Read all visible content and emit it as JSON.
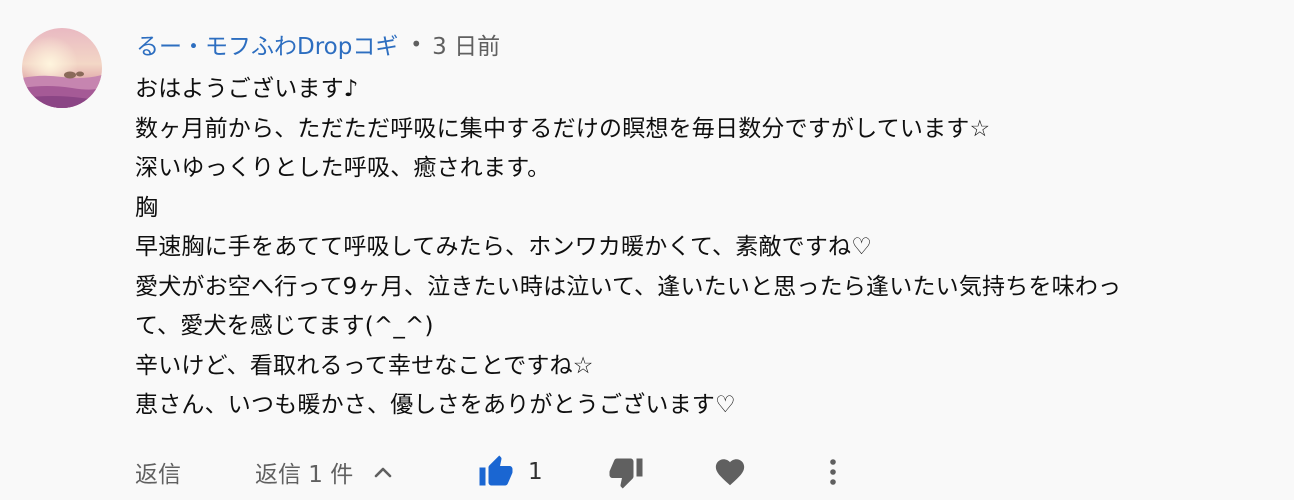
{
  "comment": {
    "author": "るー・モフふわDropコギ",
    "separator": "•",
    "time": "3 日前",
    "lines": [
      "おはようございます♪",
      "数ヶ月前から、ただただ呼吸に集中するだけの瞑想を毎日数分ですがしています☆",
      "深いゆっくりとした呼吸、癒されます。",
      "胸",
      "早速胸に手をあてて呼吸してみたら、ホンワカ暖かくて、素敵ですね♡",
      "愛犬がお空へ行って9ヶ月、泣きたい時は泣いて、逢いたいと思ったら逢いたい気持ちを味わっ",
      "て、愛犬を感じてます(^_^)",
      "辛いけど、看取れるって幸せなことですね☆",
      "恵さん、いつも暖かさ、優しさをありがとうございます♡"
    ]
  },
  "actions": {
    "reply_label": "返信",
    "replies_label": "返信 1 件",
    "like_count": "1"
  },
  "icons": {
    "replies_toggle": "chevron-up-icon",
    "like": "thumbs-up-icon",
    "dislike": "thumbs-down-icon",
    "heart": "heart-icon",
    "menu": "more-vert-icon"
  },
  "colors": {
    "author": "#2d6ec0",
    "like_active": "#1a66d2",
    "muted": "#606060",
    "background": "#f9f9f9"
  }
}
